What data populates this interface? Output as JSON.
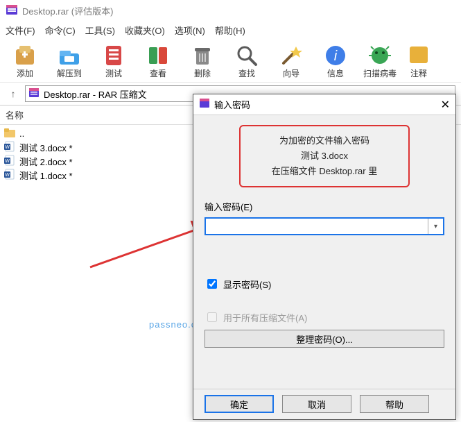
{
  "titlebar": {
    "title": "Desktop.rar (评估版本)"
  },
  "menus": {
    "file": "文件(F)",
    "cmd": "命令(C)",
    "tools": "工具(S)",
    "fav": "收藏夹(O)",
    "opt": "选项(N)",
    "help": "帮助(H)"
  },
  "toolbar": {
    "add": "添加",
    "extract": "解压到",
    "test": "测试",
    "view": "查看",
    "delete": "删除",
    "find": "查找",
    "wizard": "向导",
    "info": "信息",
    "scan": "扫描病毒",
    "comment": "注释"
  },
  "addr": {
    "text": "Desktop.rar - RAR 压缩文"
  },
  "list": {
    "header": "名称",
    "up": "..",
    "files": [
      "测试 3.docx *",
      "测试 2.docx *",
      "测试 1.docx *"
    ]
  },
  "watermark": "passneo.cn",
  "dialog": {
    "title": "输入密码",
    "msg1": "为加密的文件输入密码",
    "msg2": "测试 3.docx",
    "msg3": "在压缩文件 Desktop.rar 里",
    "pwd_label": "输入密码(E)",
    "pwd_value": "",
    "show_pwd": "显示密码(S)",
    "for_all": "用于所有压缩文件(A)",
    "organize": "整理密码(O)...",
    "ok": "确定",
    "cancel": "取消",
    "help": "帮助"
  }
}
